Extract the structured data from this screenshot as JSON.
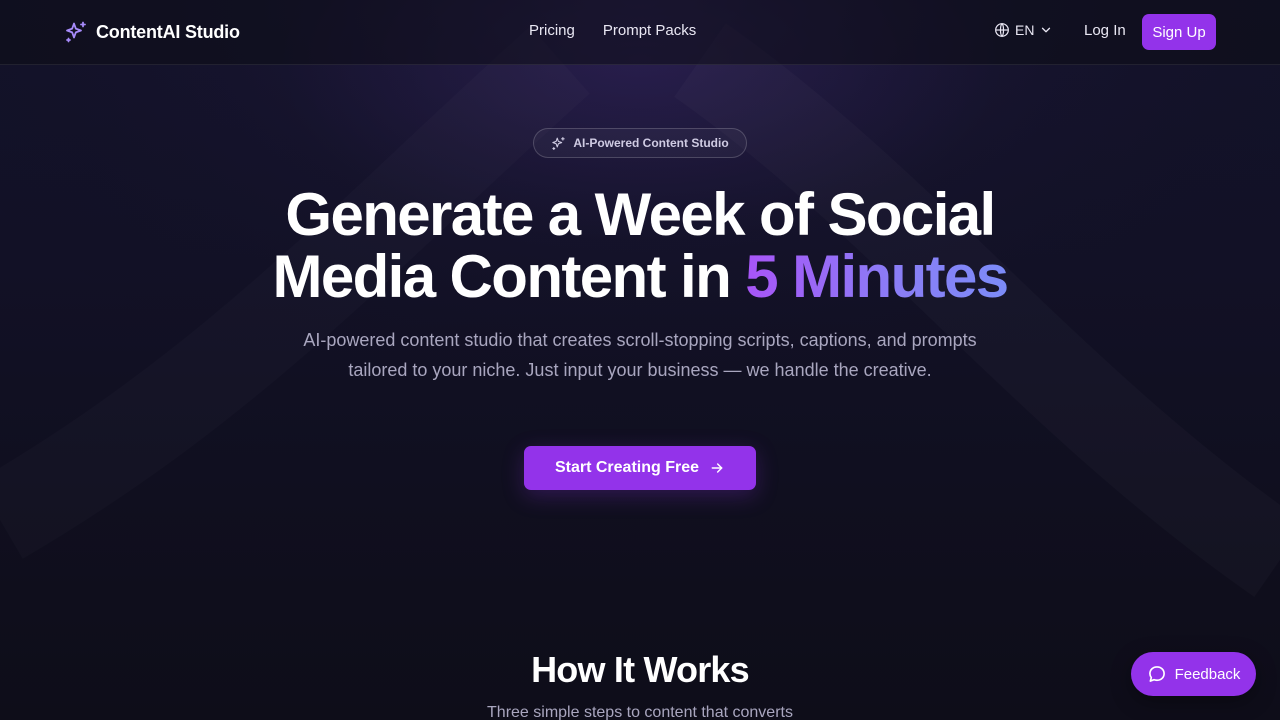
{
  "brand": {
    "name": "ContentAI Studio",
    "icon": "sparkles-icon",
    "accent": "#9333ea"
  },
  "nav": {
    "links": [
      {
        "label": "Pricing"
      },
      {
        "label": "Prompt Packs"
      }
    ],
    "language": "EN",
    "login_label": "Log In",
    "signup_label": "Sign Up"
  },
  "hero": {
    "badge": "AI-Powered Content Studio",
    "headline_line1": "Generate a Week of Social",
    "headline_line2_plain": "Media Content in",
    "headline_line2_accent": "5 Minutes",
    "subtitle": "AI-powered content studio that creates scroll-stopping scripts, captions, and prompts tailored to your niche. Just input your business — we handle the creative.",
    "cta_label": "Start Creating Free"
  },
  "how_it_works": {
    "title": "How It Works",
    "subtitle": "Three simple steps to content that converts"
  },
  "feedback": {
    "label": "Feedback"
  },
  "colors": {
    "background": "#0f0e1a",
    "primary": "#9333ea",
    "accent_gradient_start": "#a855f7",
    "accent_gradient_end": "#7c8cf8",
    "muted_text": "#a9a6bf"
  }
}
